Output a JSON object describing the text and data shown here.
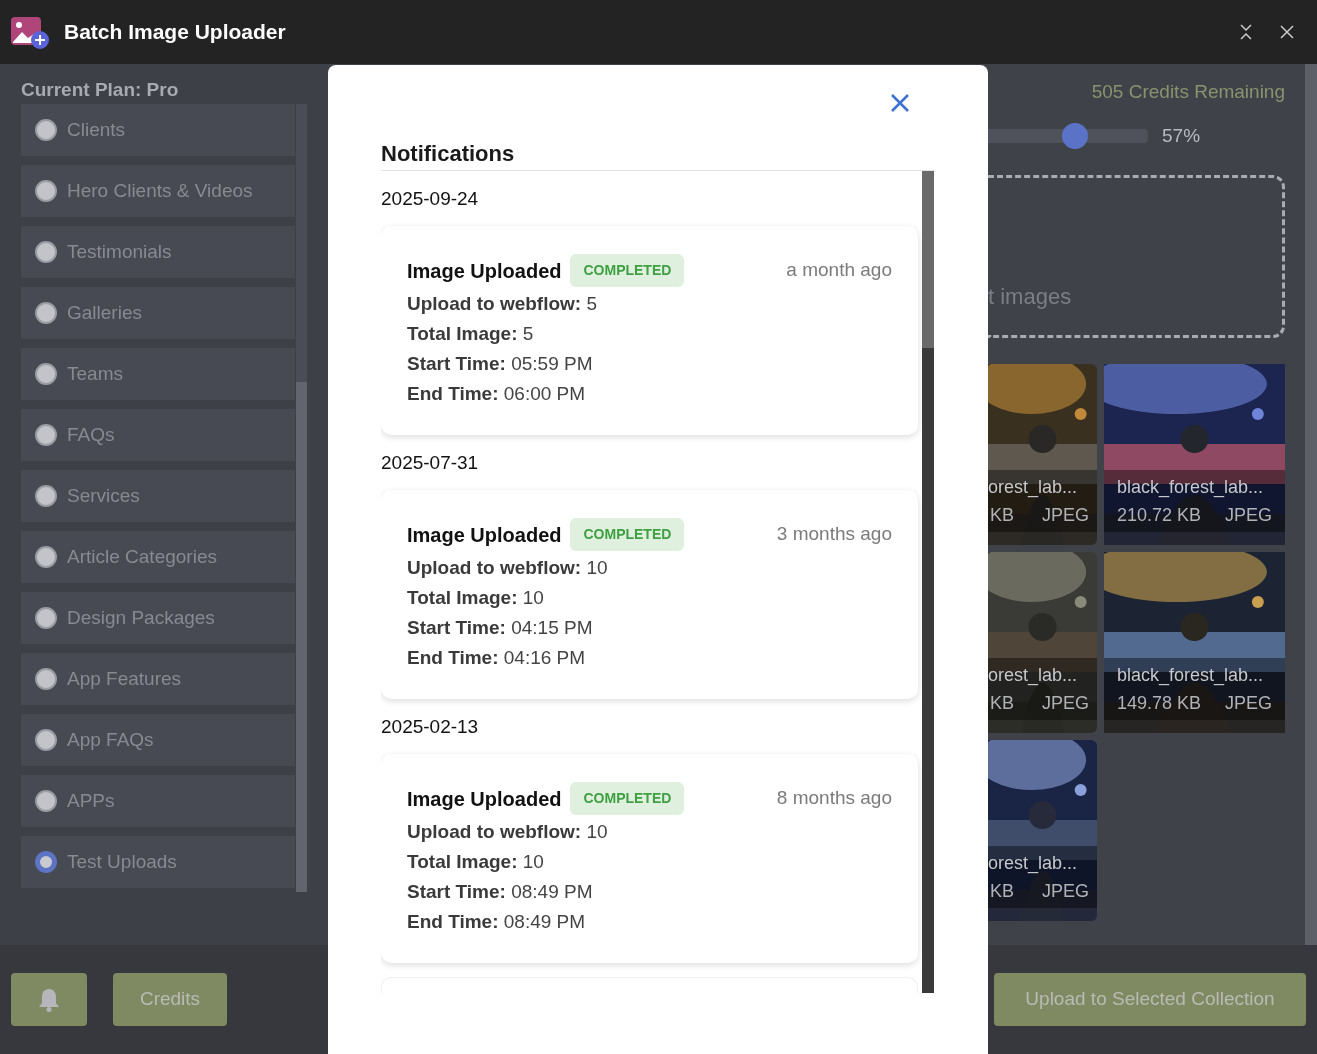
{
  "window": {
    "title": "Batch Image Uploader"
  },
  "sidebar": {
    "plan_label": "Current Plan: Pro",
    "collections": [
      {
        "label": "Clients",
        "selected": false
      },
      {
        "label": "Hero Clients & Videos",
        "selected": false
      },
      {
        "label": "Testimonials",
        "selected": false
      },
      {
        "label": "Galleries",
        "selected": false
      },
      {
        "label": "Teams",
        "selected": false
      },
      {
        "label": "FAQs",
        "selected": false
      },
      {
        "label": "Services",
        "selected": false
      },
      {
        "label": "Article Categories",
        "selected": false
      },
      {
        "label": "Design Packages",
        "selected": false
      },
      {
        "label": "App Features",
        "selected": false
      },
      {
        "label": "App FAQs",
        "selected": false
      },
      {
        "label": "APPs",
        "selected": false
      },
      {
        "label": "Test Uploads",
        "selected": true
      }
    ]
  },
  "main": {
    "credits_remaining": "505 Credits Remaining",
    "slider": {
      "level": 0.57,
      "reading": "57%"
    },
    "drop_zone_text": "t images",
    "images": [
      {
        "name": "orest_lab...",
        "size": "KB",
        "type": "JPEG",
        "kind": "picture"
      },
      {
        "name": "black_forest_lab...",
        "size": "210.72 KB",
        "type": "JPEG",
        "kind": "picture"
      },
      {
        "name": "orest_lab...",
        "size": "KB",
        "type": "JPEG",
        "kind": "picture"
      },
      {
        "name": "black_forest_lab...",
        "size": "149.78 KB",
        "type": "JPEG",
        "kind": "picture"
      },
      {
        "name": "orest_lab...",
        "size": "KB",
        "type": "JPEG",
        "kind": "picture"
      }
    ]
  },
  "notifications": {
    "title": "Notifications",
    "groups": [
      {
        "date": "2025-09-24",
        "title": "Image Uploaded",
        "status": "COMPLETED",
        "ago": "a month ago",
        "fields": [
          {
            "label": "Upload to webflow:",
            "value": "5"
          },
          {
            "label": "Total Image:",
            "value": "5"
          },
          {
            "label": "Start Time:",
            "value": "05:59 PM"
          },
          {
            "label": "End Time:",
            "value": "06:00 PM"
          }
        ]
      },
      {
        "date": "2025-07-31",
        "title": "Image Uploaded",
        "status": "COMPLETED",
        "ago": "3 months ago",
        "fields": [
          {
            "label": "Upload to webflow:",
            "value": "10"
          },
          {
            "label": "Total Image:",
            "value": "10"
          },
          {
            "label": "Start Time:",
            "value": "04:15 PM"
          },
          {
            "label": "End Time:",
            "value": "04:16 PM"
          }
        ]
      },
      {
        "date": "2025-02-13",
        "title": "Image Uploaded",
        "status": "COMPLETED",
        "ago": "8 months ago",
        "fields": [
          {
            "label": "Upload to webflow:",
            "value": "10"
          },
          {
            "label": "Total Image:",
            "value": "10"
          },
          {
            "label": "Start Time:",
            "value": "08:49 PM"
          },
          {
            "label": "End Time:",
            "value": "08:49 PM"
          }
        ]
      }
    ]
  },
  "footer": {
    "credits_button": "Credits",
    "upload_button": "Upload to Selected Collection"
  }
}
